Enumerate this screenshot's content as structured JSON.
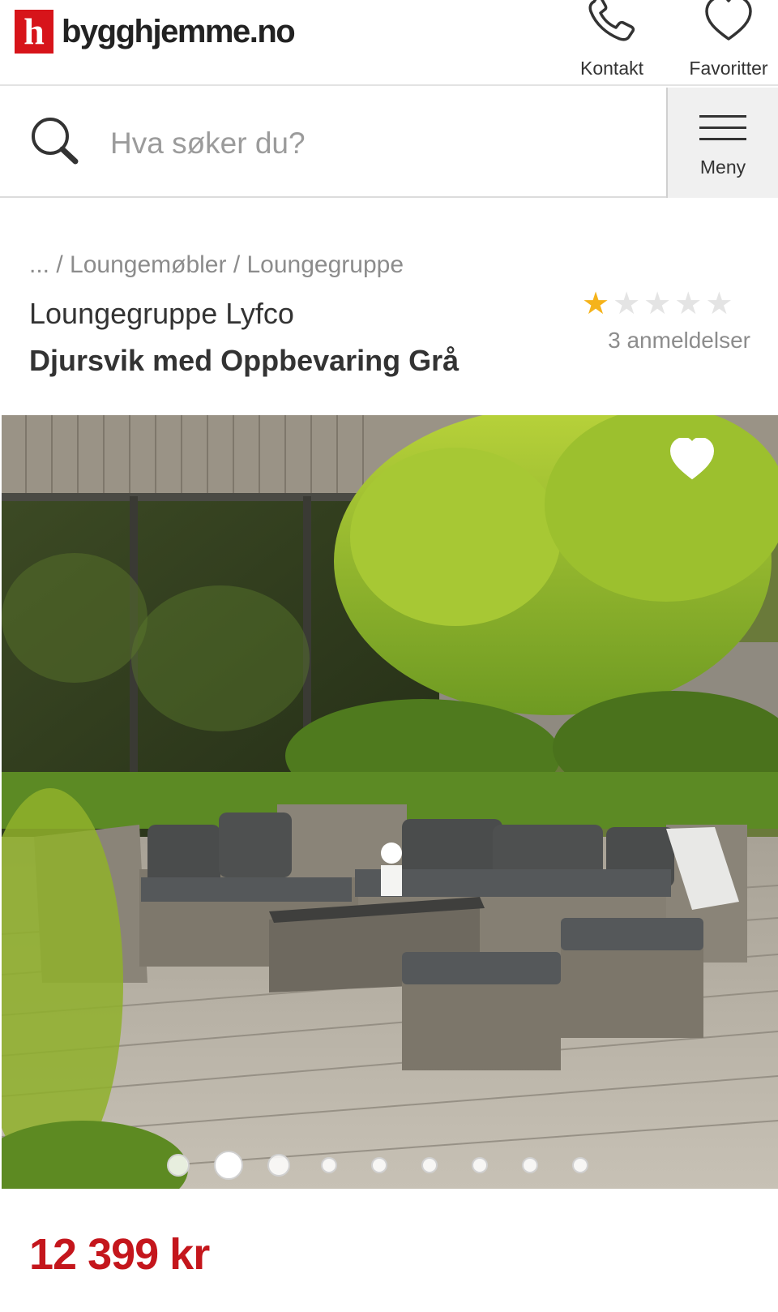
{
  "header": {
    "logo_letter": "h",
    "logo_text": "bygghjemme.no",
    "contact_label": "Kontakt",
    "favorites_label": "Favoritter"
  },
  "search": {
    "placeholder": "Hva søker du?",
    "menu_label": "Meny"
  },
  "breadcrumb": {
    "items": [
      "...",
      "Loungemøbler",
      "Loungegruppe"
    ],
    "separator": " / "
  },
  "product": {
    "title_line1": "Loungegruppe Lyfco",
    "title_line2": "Djursvik med Oppbevaring Grå",
    "rating": 1,
    "rating_max": 5,
    "reviews_text": "3 anmeldelser",
    "price": "12 399 kr"
  },
  "gallery": {
    "image_count": 9,
    "active_index": 1
  },
  "colors": {
    "brand_red": "#d7141a",
    "price_red": "#c4161c",
    "star_active": "#f5b31b",
    "star_inactive": "#e4e4e4"
  },
  "icons": {
    "contact": "phone-icon",
    "favorites": "heart-outline-icon",
    "search": "search-icon",
    "menu": "hamburger-icon",
    "image_favorite": "heart-filled-icon"
  }
}
